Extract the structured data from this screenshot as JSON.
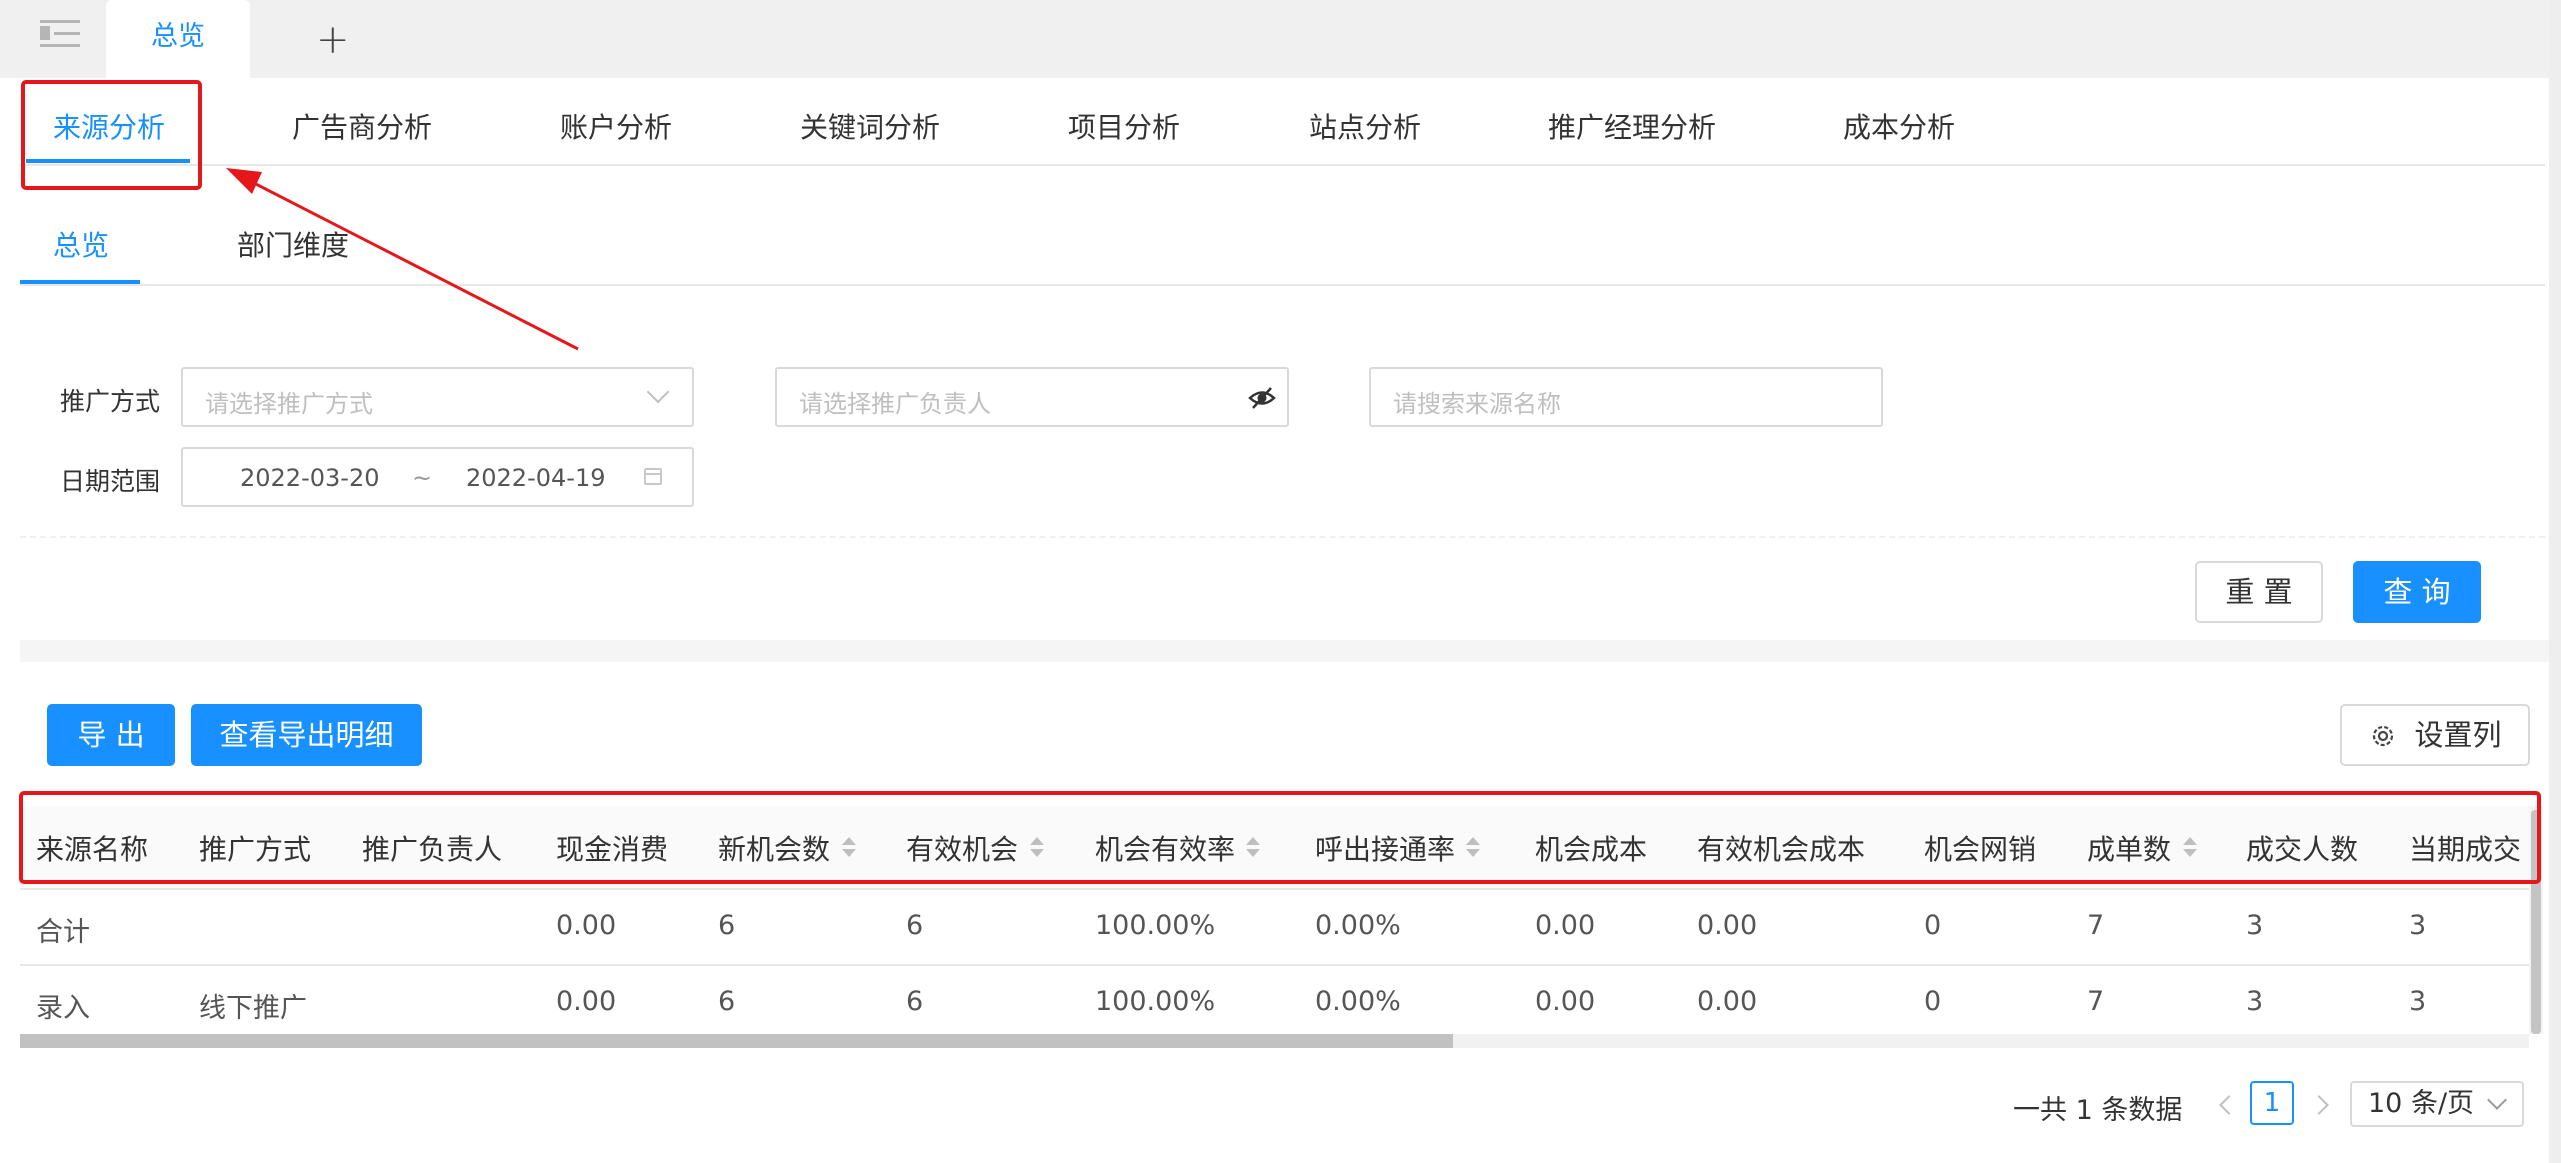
{
  "tabs": {
    "current": "总览",
    "add": "+"
  },
  "main_tabs": [
    "来源分析",
    "广告商分析",
    "账户分析",
    "关键词分析",
    "项目分析",
    "站点分析",
    "推广经理分析",
    "成本分析"
  ],
  "sub_tabs": [
    "总览",
    "部门维度"
  ],
  "filters": {
    "method_label": "推广方式",
    "method_placeholder": "请选择推广方式",
    "owner_placeholder": "请选择推广负责人",
    "source_placeholder": "请搜索来源名称",
    "date_label": "日期范围",
    "date_start": "2022-03-20",
    "date_sep": "~",
    "date_end": "2022-04-19"
  },
  "buttons": {
    "reset": "重 置",
    "query": "查 询",
    "export": "导 出",
    "export_detail": "查看导出明细",
    "columns": "设置列"
  },
  "table": {
    "columns": [
      "来源名称",
      "推广方式",
      "推广负责人",
      "现金消费",
      "新机会数",
      "有效机会",
      "机会有效率",
      "呼出接通率",
      "机会成本",
      "有效机会成本",
      "机会网销",
      "成单数",
      "成交人数",
      "当期成交"
    ],
    "rows": [
      [
        "合计",
        "",
        "",
        "0.00",
        "6",
        "6",
        "100.00%",
        "0.00%",
        "0.00",
        "0.00",
        "0",
        "7",
        "3",
        "3"
      ],
      [
        "录入",
        "线下推广",
        "",
        "0.00",
        "6",
        "6",
        "100.00%",
        "0.00%",
        "0.00",
        "0.00",
        "0",
        "7",
        "3",
        "3"
      ]
    ]
  },
  "pagination": {
    "total": "一共 1 条数据",
    "current": "1",
    "page_size": "10 条/页"
  },
  "colors": {
    "primary": "#1890ff",
    "annotation": "#e6171a"
  }
}
